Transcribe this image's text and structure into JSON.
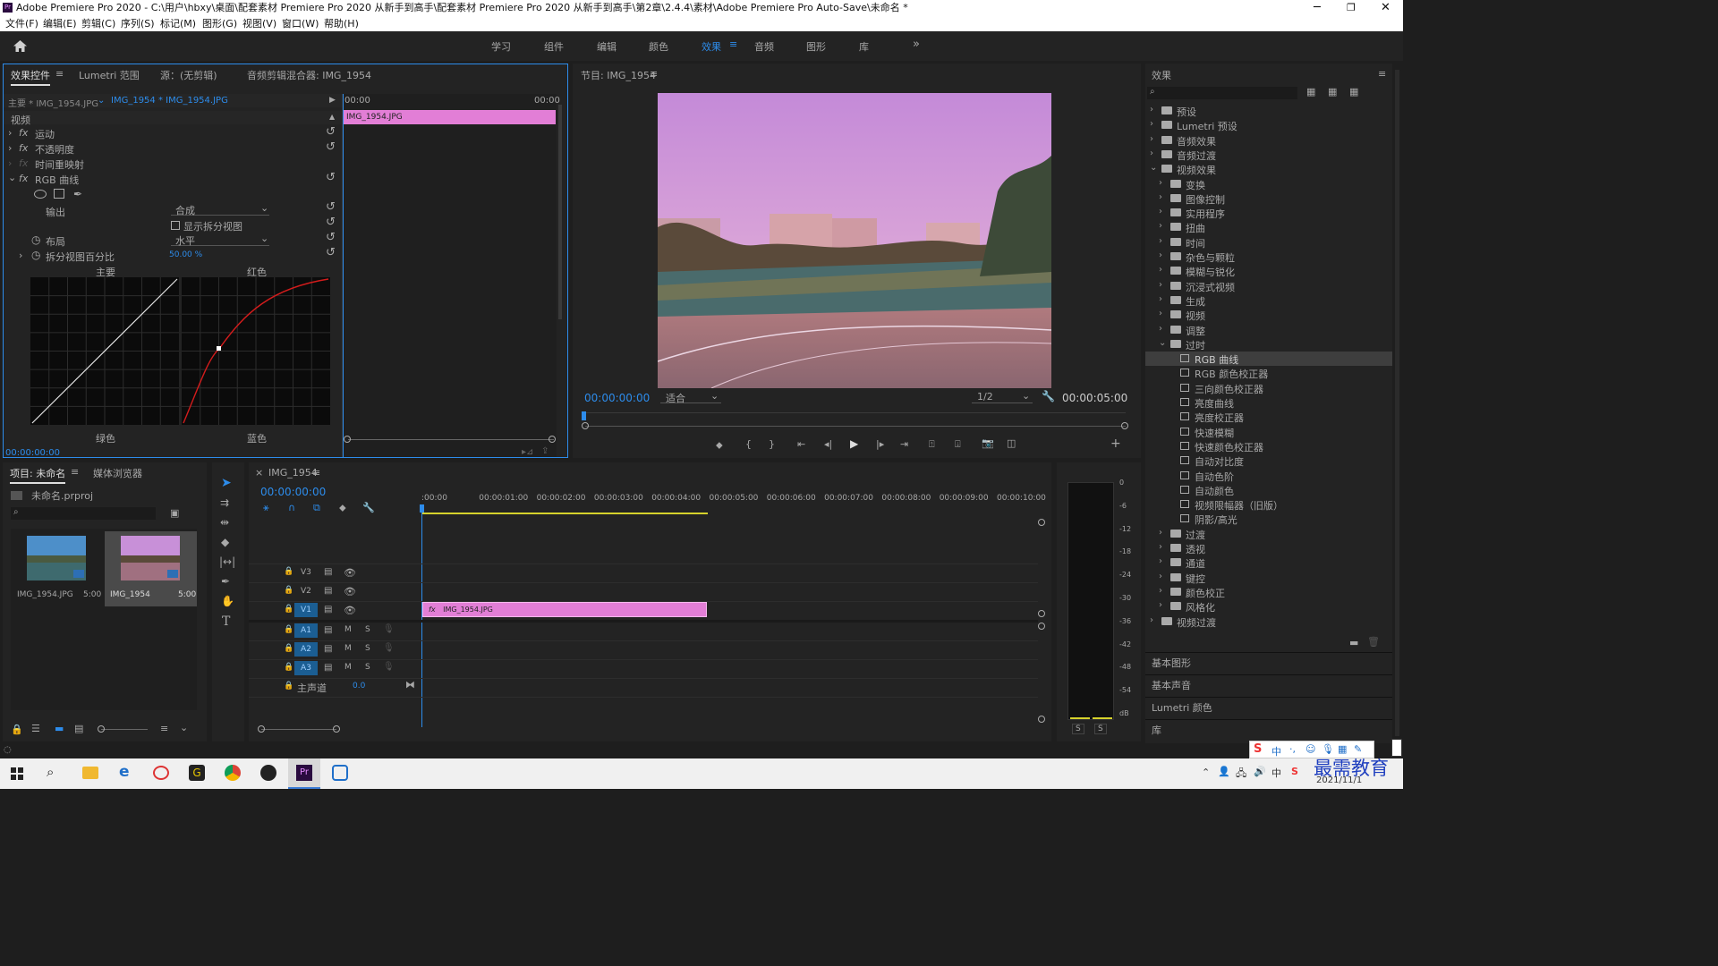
{
  "window": {
    "title": "Adobe Premiere Pro 2020 - C:\\用户\\hbxy\\桌面\\配套素材 Premiere Pro 2020 从新手到高手\\配套素材 Premiere Pro 2020 从新手到高手\\第2章\\2.4.4\\素材\\Adobe Premiere Pro Auto-Save\\未命名 *"
  },
  "menu": [
    "文件(F)",
    "编辑(E)",
    "剪辑(C)",
    "序列(S)",
    "标记(M)",
    "图形(G)",
    "视图(V)",
    "窗口(W)",
    "帮助(H)"
  ],
  "workspaces": [
    "学习",
    "组件",
    "编辑",
    "颜色",
    "效果",
    "音频",
    "图形",
    "库"
  ],
  "effect_controls": {
    "tabs": [
      "效果控件",
      "Lumetri 范围",
      "源：(无剪辑)",
      "音频剪辑混合器: IMG_1954"
    ],
    "master": "主要 * IMG_1954.JPG",
    "clip": "IMG_1954 * IMG_1954.JPG",
    "tl_start": "00:00",
    "tl_end": "00:00",
    "clip_bar": "IMG_1954.JPG",
    "video": "视频",
    "motion": "运动",
    "opacity": "不透明度",
    "remap": "时间重映射",
    "rgb_curves": "RGB 曲线",
    "output_label": "输出",
    "output_value": "合成",
    "split_view": "显示拆分视图",
    "layout_label": "布局",
    "layout_value": "水平",
    "split_pct_label": "拆分视图百分比",
    "split_pct_value": "50.00 %",
    "curve_labels": [
      "主要",
      "红色",
      "绿色",
      "蓝色"
    ],
    "timecode": "00:00:00:00"
  },
  "program": {
    "title": "节目: IMG_1954",
    "timecode": "00:00:00:00",
    "fit": "适合",
    "quality": "1/2",
    "duration": "00:00:05:00"
  },
  "project": {
    "tabs": [
      "项目: 未命名",
      "媒体浏览器"
    ],
    "file": "未命名.prproj",
    "items": [
      {
        "name": "IMG_1954.JPG",
        "dur": "5:00"
      },
      {
        "name": "IMG_1954",
        "dur": "5:00"
      }
    ]
  },
  "timeline": {
    "tab": "IMG_1954",
    "timecode": "00:00:00:00",
    "ruler": [
      ":00:00",
      "00:00:01:00",
      "00:00:02:00",
      "00:00:03:00",
      "00:00:04:00",
      "00:00:05:00",
      "00:00:06:00",
      "00:00:07:00",
      "00:00:08:00",
      "00:00:09:00",
      "00:00:10:00",
      "0"
    ],
    "video_tracks": [
      "V3",
      "V2",
      "V1"
    ],
    "audio_tracks": [
      "A1",
      "A2",
      "A3"
    ],
    "master": "主声道",
    "master_val": "0.0",
    "clip": "IMG_1954.JPG",
    "M": "M",
    "S": "S"
  },
  "meter": {
    "scale": [
      "0",
      "-6",
      "-12",
      "-18",
      "-24",
      "-30",
      "-36",
      "-42",
      "-48",
      "-54",
      "dB"
    ],
    "solo": [
      "S",
      "S"
    ]
  },
  "effects": {
    "title": "效果",
    "tree": [
      {
        "label": "预设",
        "level": 0,
        "type": "folder"
      },
      {
        "label": "Lumetri 预设",
        "level": 0,
        "type": "folder"
      },
      {
        "label": "音频效果",
        "level": 0,
        "type": "folder"
      },
      {
        "label": "音频过渡",
        "level": 0,
        "type": "folder"
      },
      {
        "label": "视频效果",
        "level": 0,
        "type": "folder",
        "open": true
      },
      {
        "label": "变换",
        "level": 1,
        "type": "folder"
      },
      {
        "label": "图像控制",
        "level": 1,
        "type": "folder"
      },
      {
        "label": "实用程序",
        "level": 1,
        "type": "folder"
      },
      {
        "label": "扭曲",
        "level": 1,
        "type": "folder"
      },
      {
        "label": "时间",
        "level": 1,
        "type": "folder"
      },
      {
        "label": "杂色与颗粒",
        "level": 1,
        "type": "folder"
      },
      {
        "label": "模糊与锐化",
        "level": 1,
        "type": "folder"
      },
      {
        "label": "沉浸式视频",
        "level": 1,
        "type": "folder"
      },
      {
        "label": "生成",
        "level": 1,
        "type": "folder"
      },
      {
        "label": "视频",
        "level": 1,
        "type": "folder"
      },
      {
        "label": "调整",
        "level": 1,
        "type": "folder"
      },
      {
        "label": "过时",
        "level": 1,
        "type": "folder",
        "open": true
      },
      {
        "label": "RGB 曲线",
        "level": 2,
        "type": "fx",
        "selected": true
      },
      {
        "label": "RGB 颜色校正器",
        "level": 2,
        "type": "fx"
      },
      {
        "label": "三向颜色校正器",
        "level": 2,
        "type": "fx"
      },
      {
        "label": "亮度曲线",
        "level": 2,
        "type": "fx"
      },
      {
        "label": "亮度校正器",
        "level": 2,
        "type": "fx"
      },
      {
        "label": "快速模糊",
        "level": 2,
        "type": "fx"
      },
      {
        "label": "快速颜色校正器",
        "level": 2,
        "type": "fx"
      },
      {
        "label": "自动对比度",
        "level": 2,
        "type": "fx"
      },
      {
        "label": "自动色阶",
        "level": 2,
        "type": "fx"
      },
      {
        "label": "自动颜色",
        "level": 2,
        "type": "fx"
      },
      {
        "label": "视频限幅器（旧版）",
        "level": 2,
        "type": "fx"
      },
      {
        "label": "阴影/高光",
        "level": 2,
        "type": "fx"
      },
      {
        "label": "过渡",
        "level": 1,
        "type": "folder"
      },
      {
        "label": "透视",
        "level": 1,
        "type": "folder"
      },
      {
        "label": "通道",
        "level": 1,
        "type": "folder"
      },
      {
        "label": "键控",
        "level": 1,
        "type": "folder"
      },
      {
        "label": "颜色校正",
        "level": 1,
        "type": "folder"
      },
      {
        "label": "风格化",
        "level": 1,
        "type": "folder"
      },
      {
        "label": "视频过渡",
        "level": 0,
        "type": "folder"
      }
    ],
    "bottom": [
      "基本图形",
      "基本声音",
      "Lumetri 颜色",
      "库"
    ]
  },
  "taskbar": {
    "date": "2021/11/1",
    "watermark": "最需教育",
    "ime": "中"
  }
}
